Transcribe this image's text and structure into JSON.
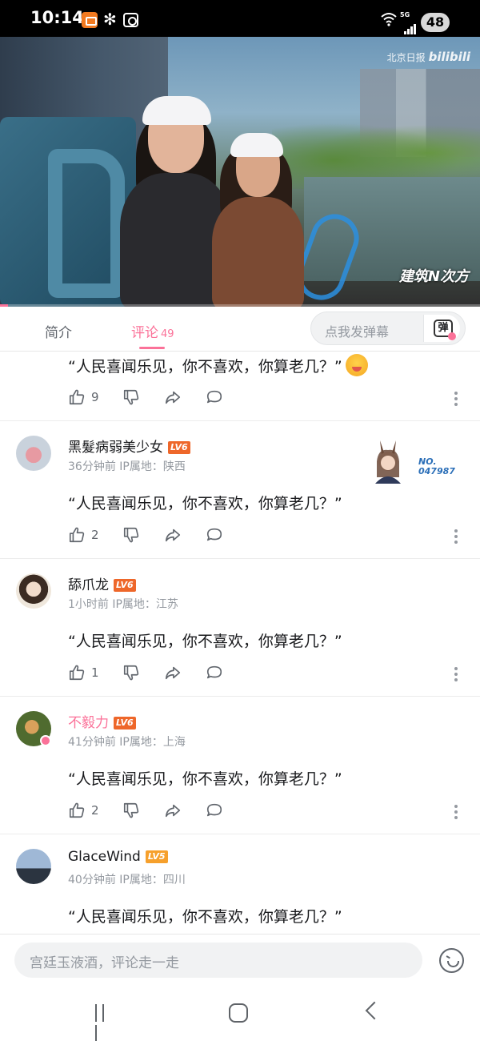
{
  "status_bar": {
    "time": "10:14",
    "network": "5G",
    "battery": "48"
  },
  "video": {
    "watermark_source": "北京日报",
    "watermark_platform": "bilibili",
    "overlay_logo": "建筑N次方"
  },
  "tabs": {
    "intro_label": "简介",
    "comments_label": "评论",
    "comments_count": "49",
    "danmaku_placeholder": "点我发弹幕",
    "danmaku_button": "弹"
  },
  "comments": [
    {
      "text": "“人民喜闻乐见，你不喜欢，你算老几？”",
      "likes": "9",
      "has_emoji": true
    },
    {
      "username": "黑髮病弱美少女",
      "level": "LV6",
      "meta": "36分钟前 IP属地：陕西",
      "text": "“人民喜闻乐见，你不喜欢，你算老几？”",
      "likes": "2",
      "pendant_no": "NO.",
      "pendant_id": "047987"
    },
    {
      "username": "舔爪龙",
      "level": "LV6",
      "meta": "1小时前 IP属地：江苏",
      "text": "“人民喜闻乐见，你不喜欢，你算老几？”",
      "likes": "1"
    },
    {
      "username": "不毅力",
      "level": "LV6",
      "meta": "41分钟前 IP属地：上海",
      "text": "“人民喜闻乐见，你不喜欢，你算老几？”",
      "likes": "2",
      "badge": "大"
    },
    {
      "username": "GlaceWind",
      "level": "LV5",
      "meta": "40分钟前 IP属地：四川",
      "text": "“人民喜闻乐见，你不喜欢，你算老几？”"
    }
  ],
  "input": {
    "placeholder": "宫廷玉液酒，评论走一走"
  },
  "colors": {
    "accent": "#fb7299",
    "level6": "#ee672a",
    "level5": "#f6a02c"
  }
}
